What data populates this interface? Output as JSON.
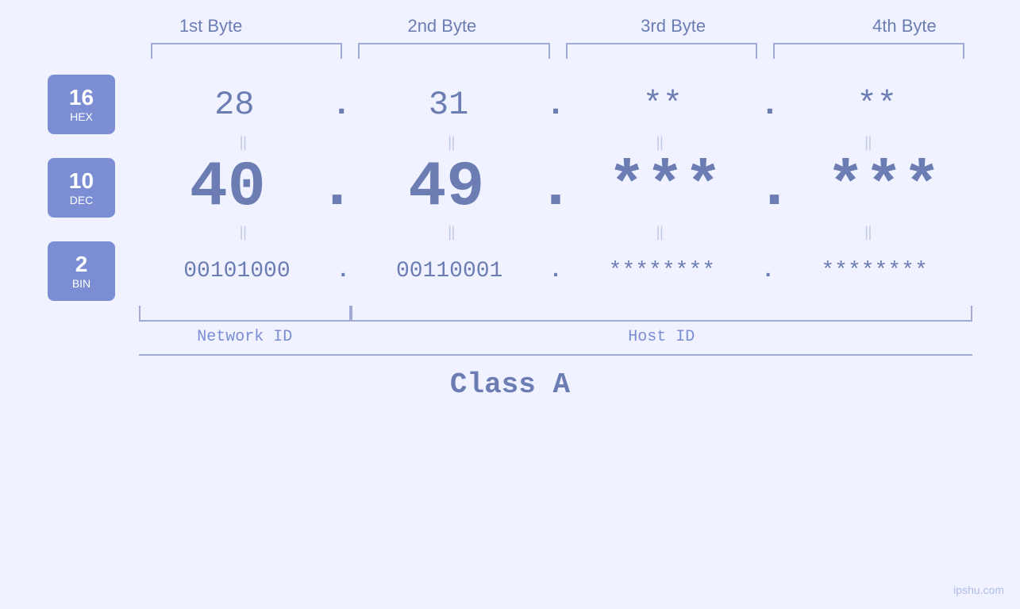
{
  "header": {
    "byte1": "1st Byte",
    "byte2": "2nd Byte",
    "byte3": "3rd Byte",
    "byte4": "4th Byte"
  },
  "badges": {
    "hex": {
      "number": "16",
      "label": "HEX"
    },
    "dec": {
      "number": "10",
      "label": "DEC"
    },
    "bin": {
      "number": "2",
      "label": "BIN"
    }
  },
  "hex_row": {
    "b1": "28",
    "b2": "31",
    "b3": "**",
    "b4": "**"
  },
  "dec_row": {
    "b1": "40",
    "b2": "49",
    "b3": "***",
    "b4": "***"
  },
  "bin_row": {
    "b1": "00101000",
    "b2": "00110001",
    "b3": "********",
    "b4": "********"
  },
  "labels": {
    "network_id": "Network ID",
    "host_id": "Host ID",
    "class": "Class A"
  },
  "watermark": "ipshu.com"
}
